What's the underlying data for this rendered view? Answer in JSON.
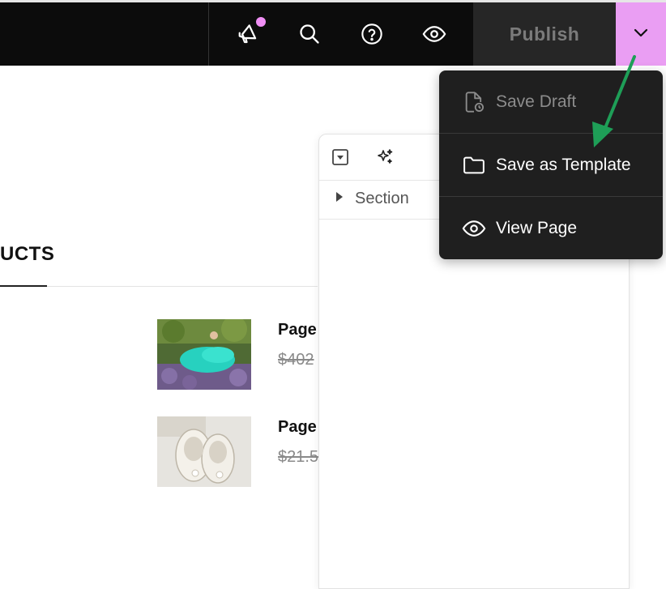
{
  "toolbar": {
    "publish_label": "Publish",
    "icons": [
      "megaphone-icon",
      "search-icon",
      "help-icon",
      "eye-icon",
      "chevron-down-icon"
    ],
    "notification_dot_color": "#f08ff5",
    "dropdown_toggle_color": "#ea9ef3"
  },
  "page": {
    "heading": "UCTS",
    "products": [
      {
        "title": "Page",
        "price": "$402"
      },
      {
        "title": "Page",
        "price": "$21.5"
      }
    ]
  },
  "panel": {
    "section_label": "Section"
  },
  "menu": {
    "items": [
      {
        "label": "Save Draft",
        "icon": "file-clock-icon",
        "disabled": true
      },
      {
        "label": "Save as Template",
        "icon": "folder-icon",
        "disabled": false
      },
      {
        "label": "View Page",
        "icon": "eye-icon",
        "disabled": false
      }
    ]
  },
  "annotation": {
    "arrow_color": "#1e9e57"
  }
}
